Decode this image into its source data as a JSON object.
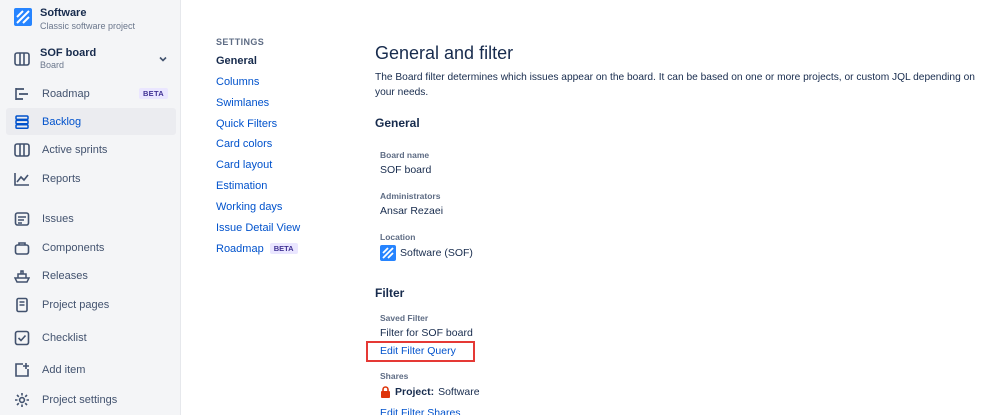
{
  "project": {
    "name": "Software",
    "type": "Classic software project"
  },
  "board": {
    "name": "SOF board",
    "type": "Board"
  },
  "sidebar": {
    "items": [
      {
        "label": "Roadmap",
        "badge": "BETA"
      },
      {
        "label": "Backlog"
      },
      {
        "label": "Active sprints"
      },
      {
        "label": "Reports"
      },
      {
        "label": "Issues"
      },
      {
        "label": "Components"
      },
      {
        "label": "Releases"
      },
      {
        "label": "Project pages"
      },
      {
        "label": "Checklist"
      },
      {
        "label": "Add item"
      },
      {
        "label": "Project settings"
      }
    ]
  },
  "settings_nav": {
    "heading": "SETTINGS",
    "items": [
      {
        "label": "General"
      },
      {
        "label": "Columns"
      },
      {
        "label": "Swimlanes"
      },
      {
        "label": "Quick Filters"
      },
      {
        "label": "Card colors"
      },
      {
        "label": "Card layout"
      },
      {
        "label": "Estimation"
      },
      {
        "label": "Working days"
      },
      {
        "label": "Issue Detail View"
      },
      {
        "label": "Roadmap",
        "badge": "BETA"
      }
    ]
  },
  "main": {
    "title": "General and filter",
    "intro": "The Board filter determines which issues appear on the board. It can be based on one or more projects, or custom JQL depending on your needs.",
    "general": {
      "heading": "General",
      "board_name_label": "Board name",
      "board_name": "SOF board",
      "admins_label": "Administrators",
      "admins": "Ansar Rezaei",
      "location_label": "Location",
      "location": "Software (SOF)"
    },
    "filter": {
      "heading": "Filter",
      "saved_filter_label": "Saved Filter",
      "saved_filter": "Filter for SOF board",
      "edit_query": "Edit Filter Query",
      "shares_label": "Shares",
      "shares_prefix": "Project:",
      "shares_value": "Software",
      "edit_shares": "Edit Filter Shares"
    }
  },
  "colors": {
    "accent": "#0052cc",
    "highlight": "#e53935",
    "sidebar_bg": "#f4f5f7"
  }
}
